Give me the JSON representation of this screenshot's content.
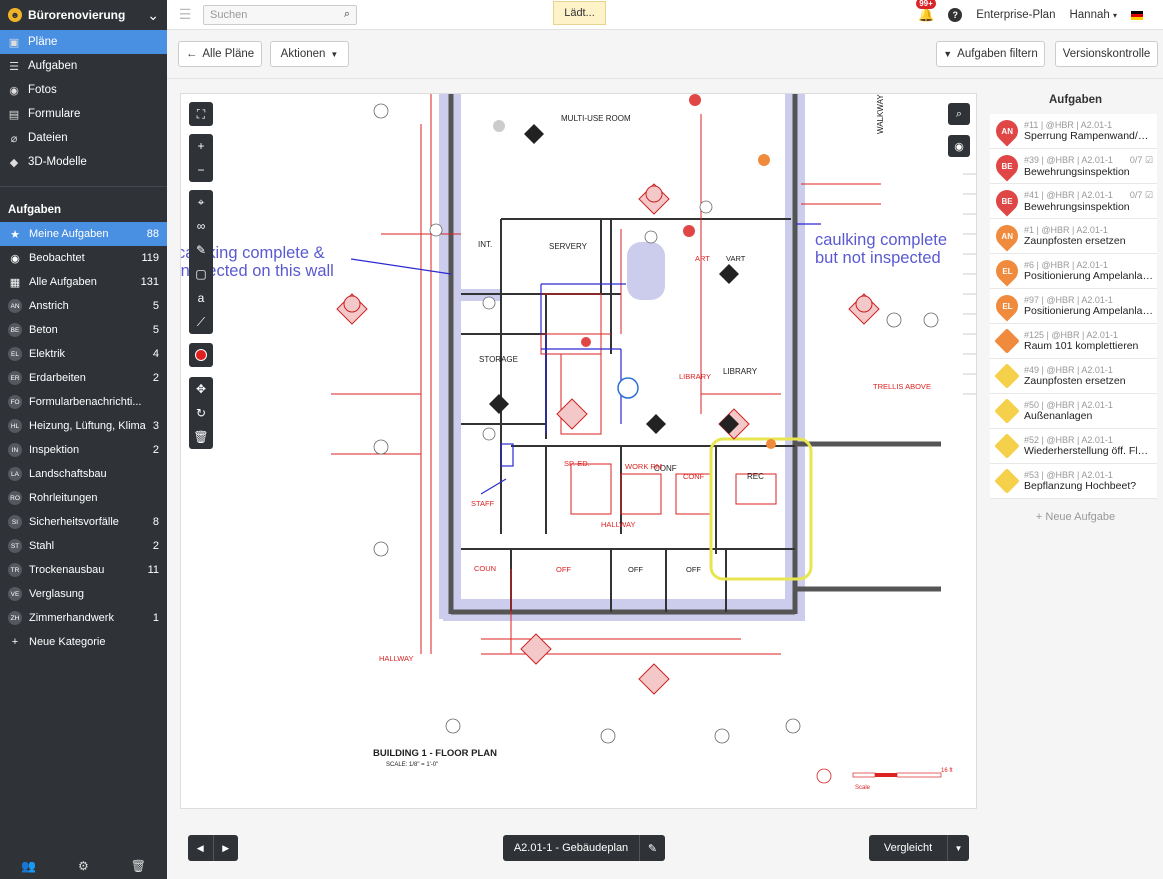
{
  "app": {
    "project_name": "Bürorenovierung",
    "logo_glyph": "☻",
    "chevron": "⌄"
  },
  "nav": [
    {
      "label": "Pläne",
      "icon": "plans-icon",
      "glyph": "▣",
      "active": true
    },
    {
      "label": "Aufgaben",
      "icon": "list-icon",
      "glyph": "☰",
      "active": false
    },
    {
      "label": "Fotos",
      "icon": "camera-icon",
      "glyph": "◉",
      "active": false
    },
    {
      "label": "Formulare",
      "icon": "forms-icon",
      "glyph": "▤",
      "active": false
    },
    {
      "label": "Dateien",
      "icon": "paperclip-icon",
      "glyph": "⌀",
      "active": false
    },
    {
      "label": "3D-Modelle",
      "icon": "cube-icon",
      "glyph": "◆",
      "active": false
    }
  ],
  "tasks_section": {
    "title": "Aufgaben",
    "items": [
      {
        "badge": "★",
        "label": "Meine Aufgaben",
        "count": "88",
        "active": true
      },
      {
        "badge": "◉",
        "label": "Beobachtet",
        "count": "119",
        "active": false
      },
      {
        "badge": "▦",
        "label": "Alle Aufgaben",
        "count": "131",
        "active": false
      },
      {
        "badge": "AN",
        "label": "Anstrich",
        "count": "5",
        "active": false
      },
      {
        "badge": "BE",
        "label": "Beton",
        "count": "5",
        "active": false
      },
      {
        "badge": "EL",
        "label": "Elektrik",
        "count": "4",
        "active": false
      },
      {
        "badge": "ER",
        "label": "Erdarbeiten",
        "count": "2",
        "active": false
      },
      {
        "badge": "FO",
        "label": "Formularbenachrichti...",
        "count": "",
        "active": false
      },
      {
        "badge": "HL",
        "label": "Heizung, Lüftung, Klima",
        "count": "3",
        "active": false
      },
      {
        "badge": "IN",
        "label": "Inspektion",
        "count": "2",
        "active": false
      },
      {
        "badge": "LA",
        "label": "Landschaftsbau",
        "count": "",
        "active": false
      },
      {
        "badge": "RO",
        "label": "Rohrleitungen",
        "count": "",
        "active": false
      },
      {
        "badge": "SI",
        "label": "Sicherheitsvorfälle",
        "count": "8",
        "active": false
      },
      {
        "badge": "ST",
        "label": "Stahl",
        "count": "2",
        "active": false
      },
      {
        "badge": "TR",
        "label": "Trockenausbau",
        "count": "11",
        "active": false
      },
      {
        "badge": "VE",
        "label": "Verglasung",
        "count": "",
        "active": false
      },
      {
        "badge": "ZH",
        "label": "Zimmerhandwerk",
        "count": "1",
        "active": false
      },
      {
        "badge": "+",
        "label": "Neue Kategorie",
        "count": "",
        "active": false
      }
    ]
  },
  "footer_icons": [
    "people-icon",
    "gear-icon",
    "trash-icon"
  ],
  "topbar": {
    "search_placeholder": "Suchen",
    "loading": "Lädt...",
    "notifications_badge": "99+",
    "help": "?",
    "plan_label": "Enterprise-Plan",
    "user": "Hannah"
  },
  "toolbar": {
    "all_plans": "Alle Pläne",
    "actions": "Aktionen",
    "filter_tasks": "Aufgaben filtern",
    "version_control": "Versionskontrolle"
  },
  "plan": {
    "sheet_name": "A2.01-1 - Gebäudeplan",
    "compare": "Vergleicht",
    "annotations": [
      "caulking complete &",
      "inspected on this wall",
      "caulking complete",
      "but not inspected"
    ],
    "rooms": [
      "MULTI-USE ROOM",
      "INT.",
      "SERVERY",
      "ART",
      "VART",
      "STORAGE",
      "LIBRARY",
      "LIBRARY",
      "CONF",
      "CONF",
      "REC",
      "WORK RM",
      "SP. ED.",
      "HALLWAY",
      "COUN",
      "OFF",
      "OFF",
      "OFF",
      "HALLWAY",
      "STAFF"
    ],
    "title_block": "BUILDING 1 - FLOOR PLAN",
    "scale": "SCALE: 1/8\" = 1'-0\"",
    "walkway": "WALKWAY",
    "trellis": "TRELLIS ABOVE",
    "scale_bar_end": "16 ft",
    "scale_word": "Scale"
  },
  "tasks_panel": {
    "title": "Aufgaben",
    "new_task": "+ Neue Aufgabe",
    "items": [
      {
        "badge": "AN",
        "meta": "#11 | @HBR | A2.01-1",
        "extra": "",
        "title": "Sperrung Rampenwand/T-S...",
        "color": "#e04646",
        "shape": "pin"
      },
      {
        "badge": "BE",
        "meta": "#39 | @HBR | A2.01-1",
        "extra": "0/7 ☑",
        "title": "Bewehrungsinspektion",
        "color": "#e04646",
        "shape": "pin"
      },
      {
        "badge": "BE",
        "meta": "#41 | @HBR | A2.01-1",
        "extra": "0/7 ☑",
        "title": "Bewehrungsinspektion",
        "color": "#e04646",
        "shape": "pin"
      },
      {
        "badge": "AN",
        "meta": "#1 | @HBR | A2.01-1",
        "extra": "",
        "title": "Zaunpfosten ersetzen",
        "color": "#f08a3c",
        "shape": "pin"
      },
      {
        "badge": "EL",
        "meta": "#6 | @HBR | A2.01-1",
        "extra": "",
        "title": "Positionierung Ampelanlag...",
        "color": "#f08a3c",
        "shape": "pin"
      },
      {
        "badge": "EL",
        "meta": "#97 | @HBR | A2.01-1",
        "extra": "",
        "title": "Positionierung Ampelanlag...",
        "color": "#f08a3c",
        "shape": "pin"
      },
      {
        "badge": "",
        "meta": "#125 | @HBR | A2.01-1",
        "extra": "",
        "title": "Raum 101 komplettieren",
        "color": "#f08a3c",
        "shape": "diamond"
      },
      {
        "badge": "",
        "meta": "#49 | @HBR | A2.01-1",
        "extra": "",
        "title": "Zaunpfosten ersetzen",
        "color": "#f5d04a",
        "shape": "diamond"
      },
      {
        "badge": "",
        "meta": "#50 | @HBR | A2.01-1",
        "extra": "",
        "title": "Außenanlagen",
        "color": "#f5d04a",
        "shape": "diamond"
      },
      {
        "badge": "",
        "meta": "#52 | @HBR | A2.01-1",
        "extra": "",
        "title": "Wiederherstellung öff. Fläc...",
        "color": "#f5d04a",
        "shape": "diamond"
      },
      {
        "badge": "",
        "meta": "#53 | @HBR | A2.01-1",
        "extra": "",
        "title": "Bepflanzung Hochbeet?",
        "color": "#f5d04a",
        "shape": "diamond"
      }
    ]
  }
}
